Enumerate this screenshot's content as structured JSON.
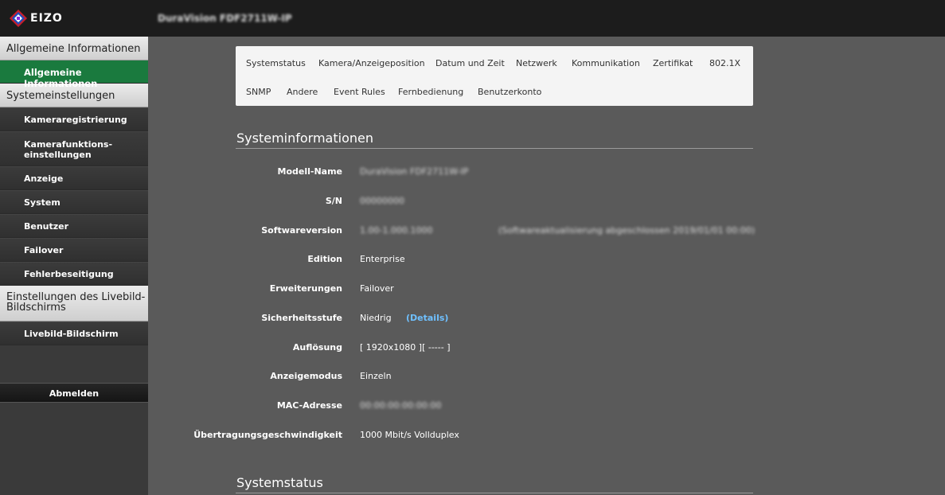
{
  "header": {
    "brand": "EIZO",
    "device_title": "DuraVision FDF2711W-IP"
  },
  "sidebar": {
    "sections": [
      {
        "title": "Allgemeine Informationen",
        "items": [
          "Allgemeine Informationen"
        ]
      },
      {
        "title": "Systemeinstellungen",
        "items": [
          "Kameraregistrierung",
          "Kamerafunktions-einstellungen",
          "Anzeige",
          "System",
          "Benutzer",
          "Failover",
          "Fehlerbeseitigung"
        ]
      },
      {
        "title": "Einstellungen des Livebild-Bildschirms",
        "items": [
          "Livebild-Bildschirm"
        ]
      }
    ],
    "sections_display": {
      "s0": "Allgemeine Informationen",
      "s1": "Systemeinstellungen",
      "s2_line1": "Einstellungen des Livebild-",
      "s2_line2": "Bildschirms"
    },
    "items_display": {
      "allgemeine": "Allgemeine Informationen",
      "kamerareg": "Kameraregistrierung",
      "kamerafunk_line1": "Kamerafunktions-",
      "kamerafunk_line2": "einstellungen",
      "anzeige": "Anzeige",
      "system": "System",
      "benutzer": "Benutzer",
      "failover": "Failover",
      "fehler": "Fehlerbeseitigung",
      "livebild": "Livebild-Bildschirm"
    },
    "active_item": "Allgemeine Informationen",
    "logout_label": "Abmelden"
  },
  "tabs": {
    "row1": [
      "Systemstatus",
      "Kamera/Anzeigeposition",
      "Datum und Zeit",
      "Netzwerk",
      "Kommunikation",
      "Zertifikat",
      "802.1X"
    ],
    "row2": [
      "SNMP",
      "Andere",
      "Event Rules",
      "Fernbedienung",
      "Benutzerkonto"
    ]
  },
  "system_info": {
    "title": "Systeminformationen",
    "rows": {
      "modell": {
        "label": "Modell-Name",
        "value": "DuraVision FDF2711W-IP"
      },
      "sn": {
        "label": "S/N",
        "value": "00000000"
      },
      "software": {
        "label": "Softwareversion",
        "value": "1.00-1.000.1000",
        "extra": "(Softwareaktualisierung abgeschlossen 2019/01/01 00:00)"
      },
      "edition": {
        "label": "Edition",
        "value": "Enterprise"
      },
      "erweiterungen": {
        "label": "Erweiterungen",
        "value": "Failover"
      },
      "sicherheit": {
        "label": "Sicherheitsstufe",
        "value": "Niedrig",
        "link_prefix": "(",
        "link": "Details",
        "link_suffix": ")"
      },
      "aufloesung": {
        "label": "Auflösung",
        "value": "[ 1920x1080 ][ ----- ]"
      },
      "anzeigemodus": {
        "label": "Anzeigemodus",
        "value": "Einzeln"
      },
      "mac": {
        "label": "MAC-Adresse",
        "value": "00:00:00:00:00:00"
      },
      "uebertragung": {
        "label": "Übertragungsgeschwindigkeit",
        "value": "1000 Mbit/s Vollduplex"
      }
    }
  },
  "system_status": {
    "title": "Systemstatus"
  },
  "colors": {
    "active_green": "#1a7a3e",
    "link_blue": "#6fc0ff",
    "background": "#5a5a5a"
  }
}
